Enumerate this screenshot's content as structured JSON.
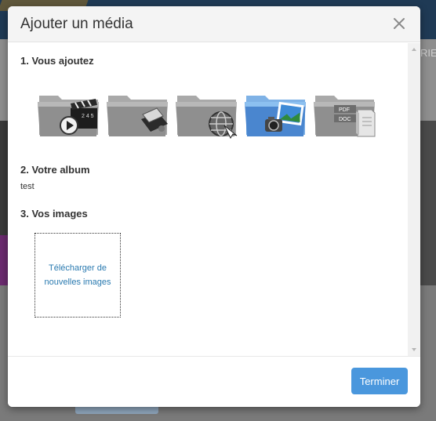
{
  "background": {
    "nav_text": "RIE"
  },
  "modal": {
    "title": "Ajouter un média",
    "sections": {
      "add": "1. Vous ajoutez",
      "album": "2. Votre album",
      "images": "3. Vos images"
    },
    "media_types": [
      {
        "icon": "video-folder-icon",
        "selected": false
      },
      {
        "icon": "presentation-folder-icon",
        "selected": false
      },
      {
        "icon": "web-folder-icon",
        "selected": false
      },
      {
        "icon": "photo-folder-icon",
        "selected": true
      },
      {
        "icon": "document-folder-icon",
        "selected": false,
        "badge_lines": [
          "PDF",
          "DOC"
        ]
      }
    ],
    "album_value": "test",
    "upload_label": "Télécharger de nouvelles images",
    "done_label": "Terminer"
  },
  "colors": {
    "accent": "#4a97dd",
    "link": "#2a7ab0",
    "folder_gray": "#8f8f8f",
    "folder_blue": "#4a86cf"
  }
}
